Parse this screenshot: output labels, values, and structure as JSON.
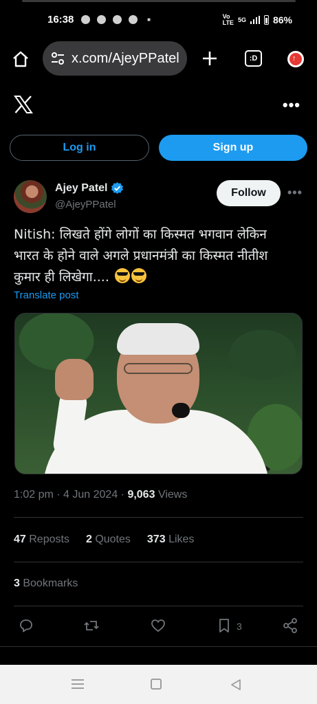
{
  "status": {
    "time": "16:38",
    "network": "5G",
    "battery": "86%"
  },
  "browser": {
    "url": "x.com/AjeyPPatel",
    "tab_count": ":D"
  },
  "auth": {
    "login_label": "Log in",
    "signup_label": "Sign up"
  },
  "author": {
    "name": "Ajey Patel",
    "handle": "@AjeyPPatel",
    "follow_label": "Follow"
  },
  "tweet": {
    "line1": "Nitish:  लिखते होंगे लोगों का किस्मत भगवान लेकिन",
    "line2": "भारत के होने वाले अगले प्रधानमंत्री का किस्मत नीतीश",
    "line3": "कुमार ही लिखेगा....",
    "translate_label": "Translate post",
    "time": "1:02 pm",
    "date": "4 Jun 2024",
    "views_count": "9,063",
    "views_label": "Views"
  },
  "stats": {
    "reposts_count": "47",
    "reposts_label": "Reposts",
    "quotes_count": "2",
    "quotes_label": "Quotes",
    "likes_count": "373",
    "likes_label": "Likes",
    "bookmarks_count": "3",
    "bookmarks_label": "Bookmarks"
  },
  "actions": {
    "bookmark_count": "3"
  },
  "colors": {
    "accent": "#1d9bf0",
    "muted": "#71767b"
  }
}
